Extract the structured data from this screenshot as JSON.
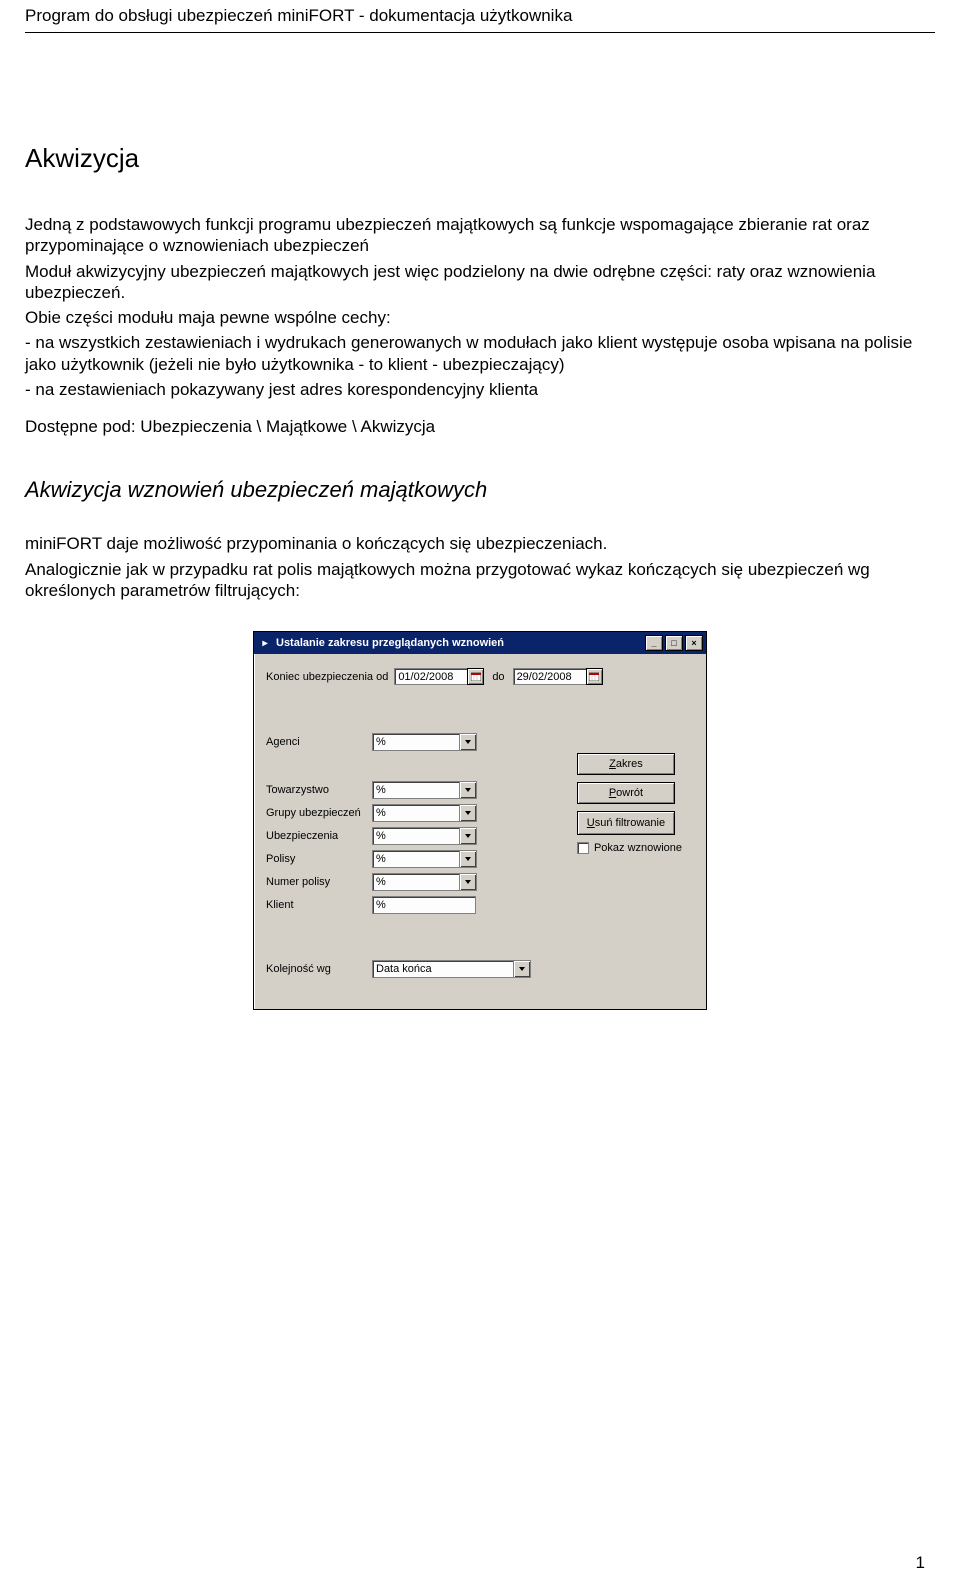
{
  "doc_header": "Program do obsługi ubezpieczeń miniFORT - dokumentacja użytkownika",
  "h1": "Akwizycja",
  "para1": "Jedną z podstawowych funkcji programu ubezpieczeń majątkowych są funkcje wspomagające zbieranie rat oraz przypominające o wznowieniach ubezpieczeń",
  "para2": "Moduł akwizycyjny ubezpieczeń majątkowych jest więc podzielony na dwie odrębne części: raty oraz wznowienia ubezpieczeń.",
  "para3": "Obie części modułu maja pewne wspólne cechy:",
  "para4": " - na wszystkich zestawieniach i wydrukach generowanych w modułach jako klient występuje osoba wpisana na polisie jako użytkownik (jeżeli nie było użytkownika - to klient - ubezpieczający)",
  "para5": " - na zestawieniach pokazywany jest adres korespondencyjny klienta",
  "para6": "Dostępne pod: Ubezpieczenia \\ Majątkowe \\ Akwizycja",
  "h2": "Akwizycja wznowień ubezpieczeń majątkowych",
  "para7": "miniFORT daje możliwość przypominania o kończących się ubezpieczeniach.",
  "para8": "Analogicznie jak w przypadku rat polis majątkowych można przygotować wykaz kończących się ubezpieczeń wg określonych parametrów filtrujących:",
  "page_num": "1",
  "dialog": {
    "title": "Ustalanie zakresu przeglądanych wznowień",
    "label_date_from": "Koniec ubezpieczenia od",
    "date_from": "01/02/2008",
    "label_date_to": "do",
    "date_to": "29/02/2008",
    "label_agenci": "Agenci",
    "label_towarzystwo": "Towarzystwo",
    "label_grupy": "Grupy ubezpieczeń",
    "label_ubezpieczenia": "Ubezpieczenia",
    "label_polisy": "Polisy",
    "label_numer_polisy": "Numer polisy",
    "label_klient": "Klient",
    "label_kolejnosc": "Kolejność wg",
    "combo_percent": "%",
    "combo_order": "Data końca",
    "btn_zakres_prefix": "Z",
    "btn_zakres_rest": "akres",
    "btn_powrot_prefix": "P",
    "btn_powrot_rest": "owrót",
    "btn_usun_prefix": "U",
    "btn_usun_rest": "suń filtrowanie",
    "checkbox_label": "Pokaz wznowione"
  }
}
